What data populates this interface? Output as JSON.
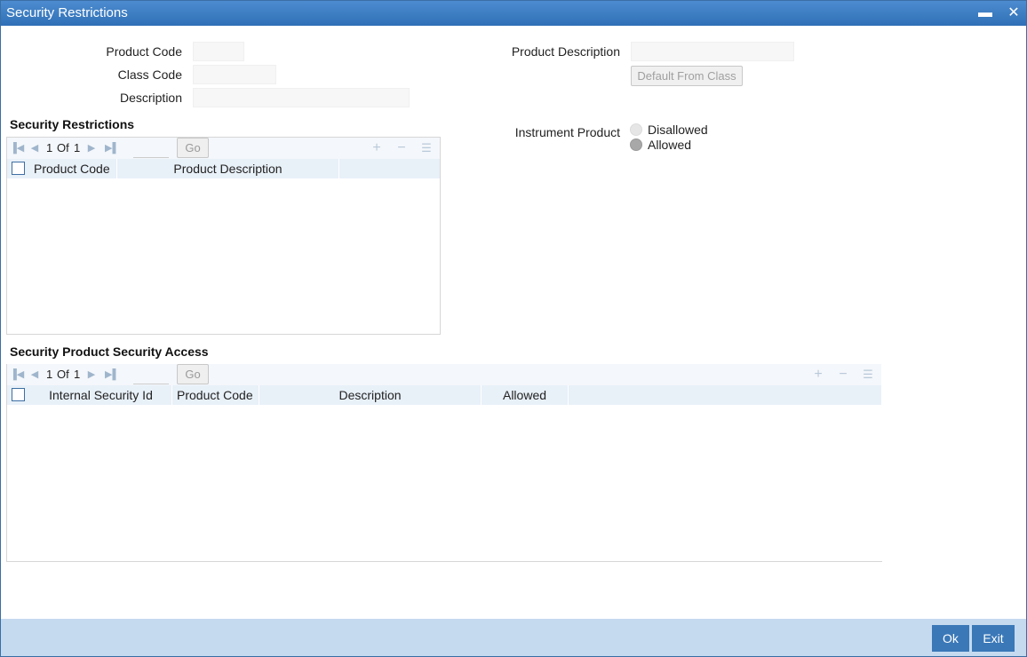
{
  "window": {
    "title": "Security Restrictions",
    "minimize_label": "▬",
    "close_label": "✕"
  },
  "form": {
    "product_code_label": "Product Code",
    "product_code_value": "",
    "class_code_label": "Class Code",
    "class_code_value": "",
    "description_label": "Description",
    "description_value": "",
    "product_description_label": "Product Description",
    "product_description_value": "",
    "default_from_class_label": "Default From Class"
  },
  "security_restrictions": {
    "title": "Security Restrictions",
    "pager": {
      "current": "1",
      "of_label": "Of",
      "total": "1",
      "go_label": "Go",
      "page_input": ""
    },
    "columns": [
      "Product Code",
      "Product Description"
    ],
    "rows": []
  },
  "instrument_product": {
    "label": "Instrument Product",
    "options": [
      "Disallowed",
      "Allowed"
    ],
    "selected": "Allowed"
  },
  "security_access": {
    "title": "Security Product Security Access",
    "pager": {
      "current": "1",
      "of_label": "Of",
      "total": "1",
      "go_label": "Go",
      "page_input": ""
    },
    "columns": [
      "Internal Security Id",
      "Product Code",
      "Description",
      "Allowed"
    ],
    "rows": []
  },
  "footer": {
    "ok_label": "Ok",
    "exit_label": "Exit"
  },
  "icons": {
    "first": "first-page-icon",
    "prev": "prev-page-icon",
    "next": "next-page-icon",
    "last": "last-page-icon",
    "add": "add-row-icon",
    "delete": "delete-row-icon",
    "columns": "single-record-view-icon"
  }
}
